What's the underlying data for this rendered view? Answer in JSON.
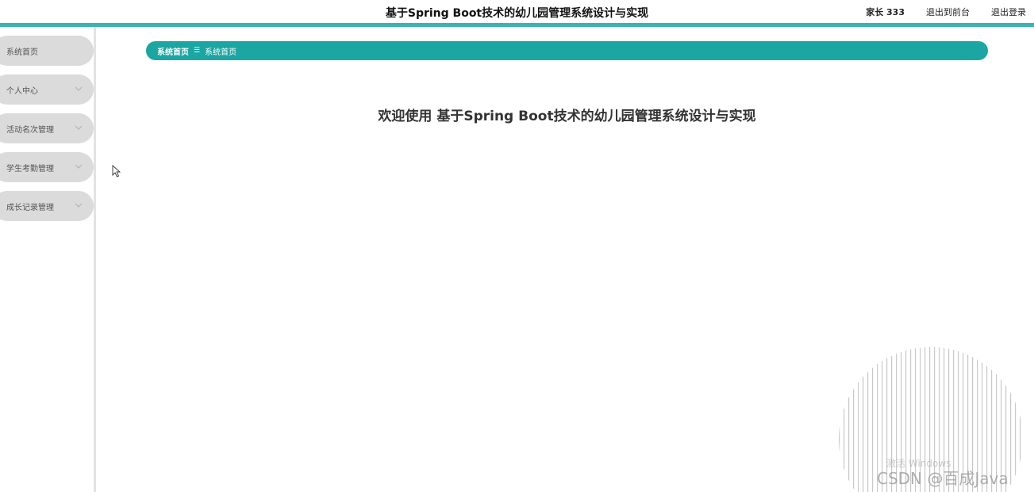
{
  "header": {
    "title": "基于Spring Boot技术的幼儿园管理系统设计与实现",
    "user": "家长 333",
    "back_to_front": "退出到前台",
    "logout": "退出登录",
    "accent_color": "#3cb4ae"
  },
  "sidebar": {
    "items": [
      {
        "label": "系统首页",
        "has_chevron": false
      },
      {
        "label": "个人中心",
        "has_chevron": true
      },
      {
        "label": "活动名次管理",
        "has_chevron": true
      },
      {
        "label": "学生考勤管理",
        "has_chevron": true
      },
      {
        "label": "成长记录管理",
        "has_chevron": true
      }
    ]
  },
  "breadcrumb": {
    "items": [
      "系统首页",
      "系统首页"
    ],
    "separator": "☰",
    "color": "#1ba6a3"
  },
  "main": {
    "welcome": "欢迎使用 基于Spring Boot技术的幼儿园管理系统设计与实现"
  },
  "watermark": {
    "windows": "激活 Windows",
    "csdn": "CSDN @百成Java"
  }
}
